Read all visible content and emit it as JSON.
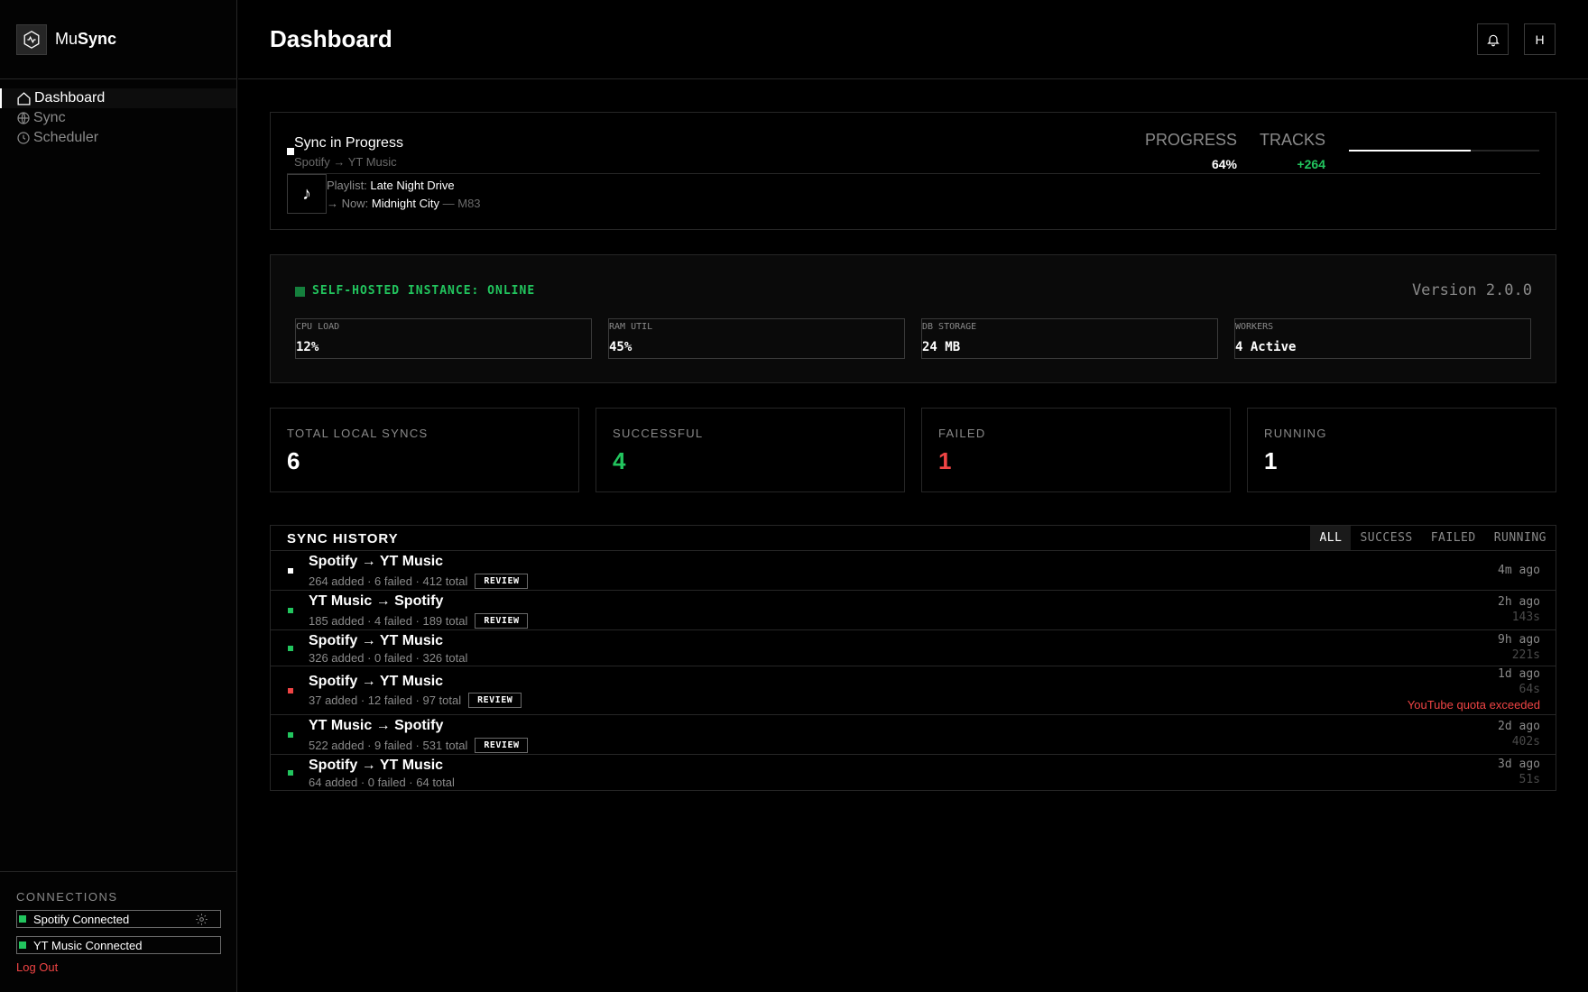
{
  "brand": {
    "prefix": "Mu",
    "suffix": "Sync"
  },
  "nav": [
    {
      "label": "Dashboard",
      "icon": "home-icon",
      "active": true
    },
    {
      "label": "Sync",
      "icon": "globe-icon",
      "active": false
    },
    {
      "label": "Scheduler",
      "icon": "clock-icon",
      "active": false
    }
  ],
  "connections": {
    "title": "CONNECTIONS",
    "items": [
      {
        "label": "Spotify Connected",
        "status_color": "#22c55e"
      },
      {
        "label": "YT Music Connected",
        "status_color": "#22c55e"
      }
    ],
    "logout_label": "Log Out"
  },
  "header": {
    "title": "Dashboard",
    "avatar_initial": "H"
  },
  "progress_card": {
    "title": "Sync in Progress",
    "direction": "Spotify → YT Music",
    "playlist_label": "Playlist:",
    "playlist_name": "Late Night Drive",
    "now_label": "→ Now:",
    "now_track": "Midnight City",
    "now_artist": "— M83",
    "progress_label": "PROGRESS",
    "progress_value": "64%",
    "progress_fraction": 0.64,
    "tracks_label": "TRACKS",
    "tracks_value": "+264"
  },
  "instance": {
    "status": "SELF-HOSTED INSTANCE: ONLINE",
    "version": "Version 2.0.0",
    "metrics": [
      {
        "label": "CPU LOAD",
        "value": "12%"
      },
      {
        "label": "RAM UTIL",
        "value": "45%"
      },
      {
        "label": "DB STORAGE",
        "value": "24 MB"
      },
      {
        "label": "WORKERS",
        "value": "4 Active"
      }
    ]
  },
  "counters": [
    {
      "label": "TOTAL LOCAL SYNCS",
      "value": "6",
      "color": "#ffffff"
    },
    {
      "label": "SUCCESSFUL",
      "value": "4",
      "color": "#22c55e"
    },
    {
      "label": "FAILED",
      "value": "1",
      "color": "#ef4444"
    },
    {
      "label": "RUNNING",
      "value": "1",
      "color": "#ffffff"
    }
  ],
  "history": {
    "title": "SYNC HISTORY",
    "filters": [
      "ALL",
      "SUCCESS",
      "FAILED",
      "RUNNING"
    ],
    "review_label": "REVIEW",
    "rows": [
      {
        "title": "Spotify → YT Music",
        "meta": "264 added · 6 failed · 412 total",
        "review": true,
        "time": "4m ago",
        "duration": "",
        "error": "",
        "status_color": "#ffffff"
      },
      {
        "title": "YT Music → Spotify",
        "meta": "185 added · 4 failed · 189 total",
        "review": true,
        "time": "2h ago",
        "duration": "143s",
        "error": "",
        "status_color": "#22c55e"
      },
      {
        "title": "Spotify → YT Music",
        "meta": "326 added · 0 failed · 326 total",
        "review": false,
        "time": "9h ago",
        "duration": "221s",
        "error": "",
        "status_color": "#22c55e"
      },
      {
        "title": "Spotify → YT Music",
        "meta": "37 added · 12 failed · 97 total",
        "review": true,
        "time": "1d ago",
        "duration": "64s",
        "error": "YouTube quota exceeded",
        "status_color": "#ef4444"
      },
      {
        "title": "YT Music → Spotify",
        "meta": "522 added · 9 failed · 531 total",
        "review": true,
        "time": "2d ago",
        "duration": "402s",
        "error": "",
        "status_color": "#22c55e"
      },
      {
        "title": "Spotify → YT Music",
        "meta": "64 added · 0 failed · 64 total",
        "review": false,
        "time": "3d ago",
        "duration": "51s",
        "error": "",
        "status_color": "#22c55e"
      }
    ]
  }
}
